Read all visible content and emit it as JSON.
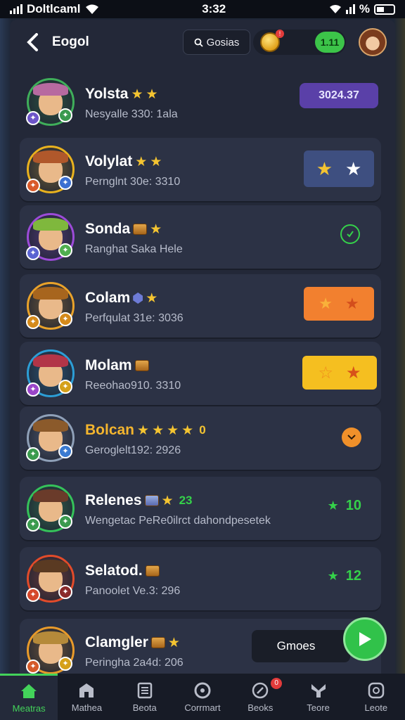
{
  "status_bar": {
    "carrier": "Doltlcaml",
    "time": "3:32",
    "battery": "%"
  },
  "header": {
    "back_icon": "chevron-left-icon",
    "title": "Eogol",
    "search_placeholder": "Gosias",
    "coin_notification": "!",
    "level": "1.11"
  },
  "players": [
    {
      "name": "Yolsta",
      "subtitle": "Nesyalle 330: 1ala",
      "right_type": "score",
      "right_value": "3024.37",
      "ring": "#3fae5a",
      "hat": "#b76aa0"
    },
    {
      "name": "Volylat",
      "subtitle": "Pernglnt 30e: 3310",
      "right_type": "stars-blue",
      "ring": "#e9b21e",
      "hat": "#b0582b"
    },
    {
      "name": "Sonda",
      "subtitle": "Ranghat Saka Hele",
      "right_type": "check",
      "ring": "#9c4bd8",
      "hat": "#7fb83d"
    },
    {
      "name": "Colam",
      "subtitle": "Perfqulat 31e: 3036",
      "right_type": "stars-orange",
      "ring": "#e9a22a",
      "hat": "#a7651e"
    },
    {
      "name": "Molam",
      "subtitle": "Reeohao910. 3310",
      "right_type": "stars-yellow",
      "ring": "#2c9ed6",
      "hat": "#b23548"
    },
    {
      "name": "Bolcan",
      "subtitle": "Geroglelt192: 2926",
      "extra": "0",
      "right_type": "orange-dot",
      "ring": "#8fa0b8",
      "hat": "#8b5a2b"
    },
    {
      "name": "Relenes",
      "subtitle": "Wengetac PeRe0ilrct dahondpesetek",
      "extra": "23",
      "right_type": "count",
      "right_value": "10",
      "ring": "#35c25a",
      "hat": "#6a3b2a"
    },
    {
      "name": "Selatod.",
      "subtitle": "Panoolet Ve.3: 296",
      "right_type": "count",
      "right_value": "12",
      "ring": "#e24b2a",
      "hat": "#5a3a22"
    },
    {
      "name": "Clamgler",
      "subtitle": "Peringha 2a4d: 206",
      "right_type": "none",
      "ring": "#e89a2a",
      "hat": "#b58a3a"
    }
  ],
  "games_button": "Gmoes",
  "nav": [
    {
      "label": "Meatras",
      "icon": "home-icon",
      "active": true
    },
    {
      "label": "Mathea",
      "icon": "store-icon"
    },
    {
      "label": "Beota",
      "icon": "list-icon"
    },
    {
      "label": "Corrmart",
      "icon": "clock-icon"
    },
    {
      "label": "Beoks",
      "icon": "compass-icon",
      "badge": "0"
    },
    {
      "label": "Teore",
      "icon": "tool-icon"
    },
    {
      "label": "Leote",
      "icon": "gauge-icon"
    }
  ],
  "colors": {
    "panel": "#232838",
    "card": "#2c3245",
    "accent_green": "#43d35a",
    "score_purple": "#5a40a8"
  }
}
